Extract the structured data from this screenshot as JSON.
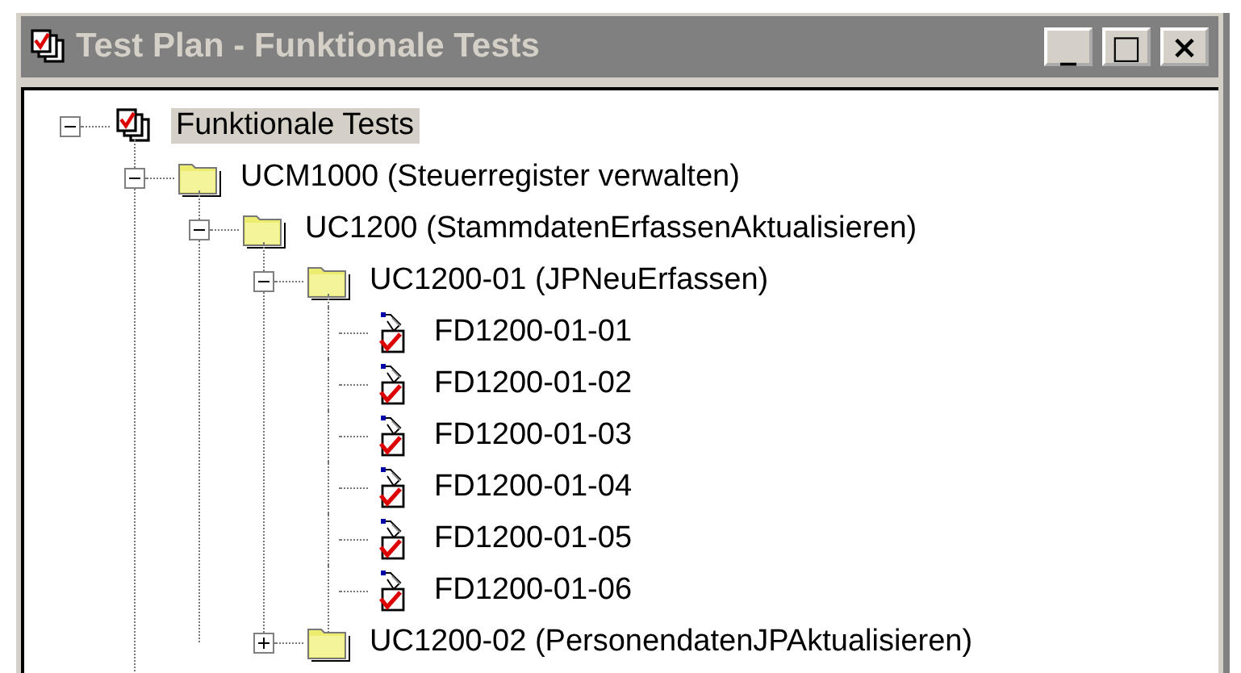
{
  "window": {
    "title": "Test Plan - Funktionale Tests",
    "buttons": [
      "_",
      "□",
      "×"
    ]
  },
  "tree": [
    {
      "label": "Funktionale Tests",
      "kind": "plan",
      "expanded": true,
      "selected": true,
      "children": [
        {
          "label": "UCM1000 (Steuerregister verwalten)",
          "kind": "folder",
          "expanded": true,
          "selected": false,
          "children": [
            {
              "label": "UC1200 (StammdatenErfassenAktualisieren)",
              "kind": "folder",
              "expanded": true,
              "selected": false,
              "children": [
                {
                  "label": "UC1200-01 (JPNeuErfassen)",
                  "kind": "folder",
                  "expanded": true,
                  "selected": false,
                  "children": [
                    {
                      "label": "FD1200-01-01",
                      "kind": "test",
                      "selected": false
                    },
                    {
                      "label": "FD1200-01-02",
                      "kind": "test",
                      "selected": false
                    },
                    {
                      "label": "FD1200-01-03",
                      "kind": "test",
                      "selected": false
                    },
                    {
                      "label": "FD1200-01-04",
                      "kind": "test",
                      "selected": false
                    },
                    {
                      "label": "FD1200-01-05",
                      "kind": "test",
                      "selected": false
                    },
                    {
                      "label": "FD1200-01-06",
                      "kind": "test",
                      "selected": false
                    }
                  ]
                },
                {
                  "label": "UC1200-02 (PersonendatenJPAktualisieren)",
                  "kind": "folder",
                  "expanded": false,
                  "selected": false
                }
              ]
            }
          ]
        }
      ]
    }
  ]
}
